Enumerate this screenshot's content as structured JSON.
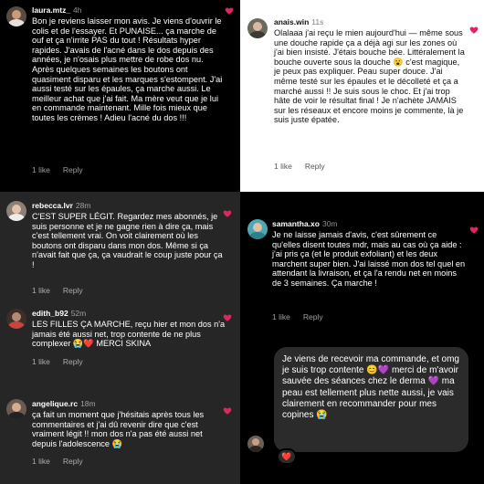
{
  "common": {
    "like_label": "1 like",
    "reply_label": "Reply"
  },
  "comments": [
    {
      "username": "laura.mtz_",
      "time": "4h",
      "text": "Bon je reviens laisser mon avis. Je viens d'ouvrir le colis et de l'essayer. Et PUNAISE... ça marche de ouf et ça n'irrite PAS du tout ! Résultats hyper rapides. J'avais de l'acné dans le dos depuis des années, je n'osais plus mettre de robe dos nu. Après quelques semaines les boutons ont quasiment disparu et les marques s'estompent. J'ai aussi testé sur les épaules, ça marche aussi. Le meilleur achat que j'ai fait. Ma mère veut que je lui en commande maintenant. Mille fois mieux que toutes les crèmes ! Adieu l'acné du dos !!!"
    },
    {
      "username": "anais.win",
      "time": "11s",
      "text": "Olalaaa j'ai reçu le mien aujourd'hui — même sous une douche rapide ça a déjà agi sur les zones où j'ai bien insisté. J'étais bouche bée. Littéralement la bouche ouverte sous la douche 😮 c'est magique, je peux pas expliquer. Peau super douce. J'ai même testé sur les épaules et le décolleté et ça a marché aussi !! Je suis sous le choc. Et j'ai trop hâte de voir le résultat final ! Je n'achète JAMAIS sur les réseaux et encore moins je commente, là je suis juste épatée."
    },
    {
      "username": "rebecca.lvr",
      "time": "28m",
      "text": "C'EST SUPER LÉGIT. Regardez mes abonnés, je suis personne et je ne gagne rien à dire ça, mais c'est tellement vrai. On voit clairement où les boutons ont disparu dans mon dos. Même si ça n'avait fait que ça, ça vaudrait le coup juste pour ça !"
    },
    {
      "username": "samantha.xo",
      "time": "30m",
      "text": "Je ne laisse jamais d'avis, c'est sûrement ce qu'elles disent toutes mdr, mais au cas où ça aide : j'ai pris ça (et le produit exfoliant) et les deux marchent super bien. J'ai laissé mon dos tel quel en attendant la livraison, et ça l'a rendu net en moins de 3 semaines. Ça marche !"
    },
    {
      "username": "edith_b92",
      "time": "52m",
      "text": "LES FILLES ÇA MARCHE, reçu hier et mon dos n'a jamais été aussi net, trop contente de ne plus complexer 😭❤️ MERCI SKINA"
    },
    {
      "username": "angelique.rc",
      "time": "18m",
      "text": "ça fait un moment que j'hésitais après tous les commentaires et j'ai dû revenir dire que c'est vraiment légit !! mon dos n'a pas été aussi net depuis l'adolescence 😭"
    }
  ],
  "message": {
    "text": "Je viens de recevoir ma commande, et omg je suis trop contente 😊💜 merci de m'avoir sauvée des séances chez le derma 💜 ma peau est tellement plus nette aussi, je vais clairement en recommander pour mes copines 😭",
    "reaction": "❤️"
  },
  "colors": {
    "heart": "#e0245e",
    "dark_panel": "#262626",
    "bubble": "#2b2b2b"
  }
}
